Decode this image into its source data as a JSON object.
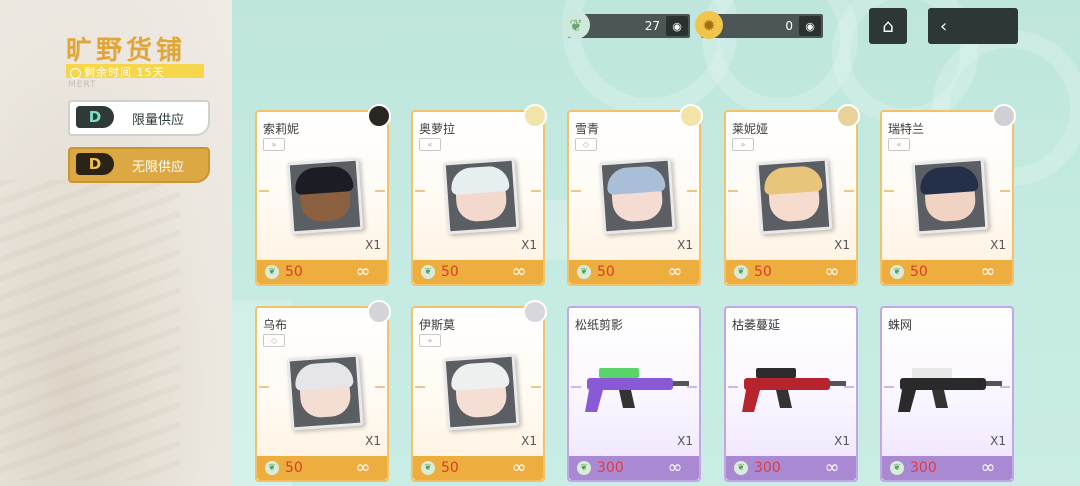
{
  "shop": {
    "title": "旷野货铺",
    "reset_text": "剩余时间 15天",
    "sub_mark": "MERT"
  },
  "tabs": [
    {
      "label": "限量供应",
      "logo": "D",
      "state": "inactive"
    },
    {
      "label": "无限供应",
      "logo": "D",
      "state": "active"
    }
  ],
  "currencies": [
    {
      "icon": "leaf-icon",
      "value": "27"
    },
    {
      "icon": "gold-ore-icon",
      "value": "0"
    }
  ],
  "nav": {
    "home_icon": "⌂",
    "back_icon": "‹"
  },
  "items": [
    {
      "name": "索莉妮",
      "type": "char",
      "type_icon": "»",
      "qty": "X1",
      "price": "50",
      "hair": "#1c1d24",
      "skin": "#8b6040",
      "avatar": "#2a2622"
    },
    {
      "name": "奥萝拉",
      "type": "char",
      "type_icon": "«",
      "qty": "X1",
      "price": "50",
      "hair": "#e7eef0",
      "skin": "#f3d9cd",
      "avatar": "#f2e3a9"
    },
    {
      "name": "雪青",
      "type": "char",
      "type_icon": "◇",
      "qty": "X1",
      "price": "50",
      "hair": "#a9bfd7",
      "skin": "#f5dcd2",
      "avatar": "#f2e3a9"
    },
    {
      "name": "莱妮娅",
      "type": "char",
      "type_icon": "»",
      "qty": "X1",
      "price": "50",
      "hair": "#e8c57a",
      "skin": "#f6dccf",
      "avatar": "#e8d29a"
    },
    {
      "name": "瑞特兰",
      "type": "char",
      "type_icon": "«",
      "qty": "X1",
      "price": "50",
      "hair": "#24304a",
      "skin": "#f0d3c3",
      "avatar": "#cfcfd6"
    },
    {
      "name": "乌布",
      "type": "char",
      "type_icon": "◇",
      "qty": "X1",
      "price": "50",
      "hair": "#e6e6ea",
      "skin": "#f4ddd2",
      "avatar": "#d3d3d8"
    },
    {
      "name": "伊斯莫",
      "type": "char",
      "type_icon": "»",
      "qty": "X1",
      "price": "50",
      "hair": "#eef0f0",
      "skin": "#f5dfd4",
      "avatar": "#d6d6dc"
    },
    {
      "name": "松纸剪影",
      "type": "weapon",
      "qty": "X1",
      "price": "300",
      "weapon_color": "#8a5ad6",
      "weapon_accent": "#59d46a"
    },
    {
      "name": "枯萎蔓延",
      "type": "weapon",
      "qty": "X1",
      "price": "300",
      "weapon_color": "#b8242d",
      "weapon_accent": "#2c2c2c"
    },
    {
      "name": "蛛网",
      "type": "weapon",
      "qty": "X1",
      "price": "300",
      "weapon_color": "#2a2a2a",
      "weapon_accent": "#e8e8e8"
    }
  ],
  "colors": {
    "char_border": "#f2c26b",
    "weapon_border": "#c2a6e6",
    "price_text": "#d63e25",
    "title": "#e0a63a"
  }
}
